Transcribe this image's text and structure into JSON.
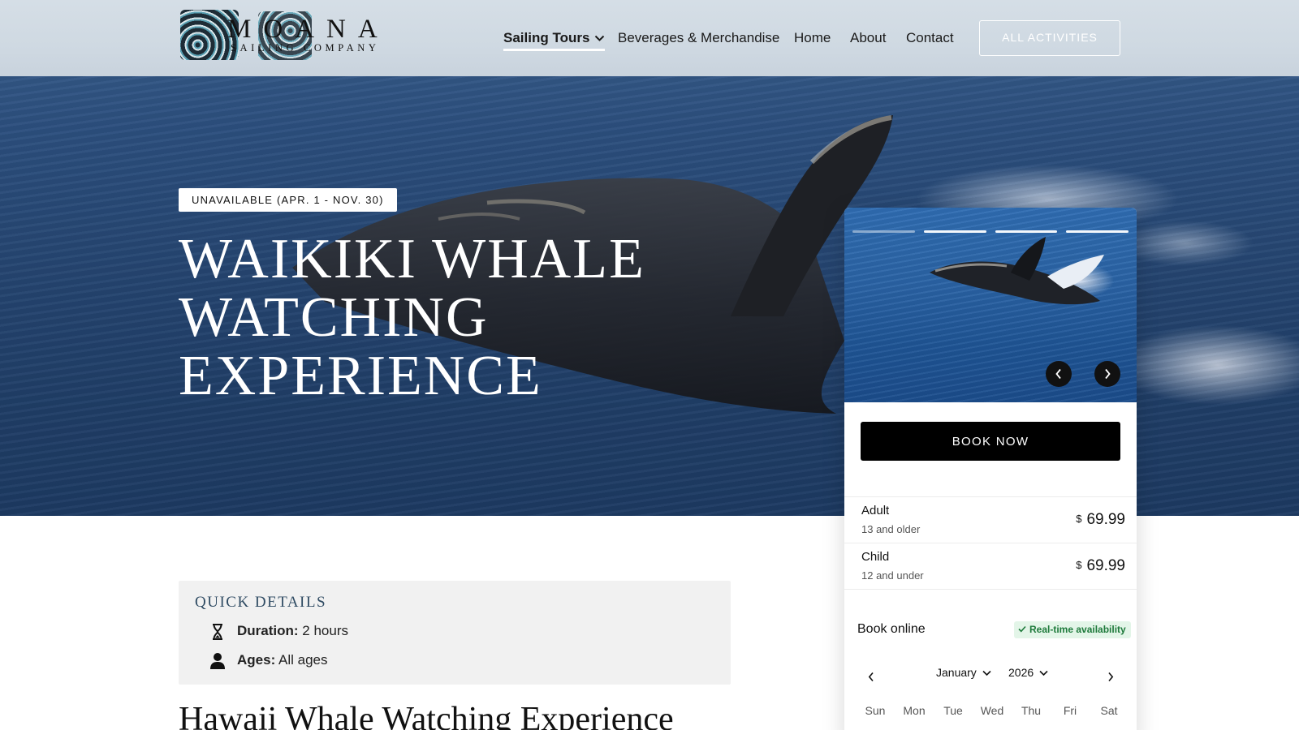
{
  "header": {
    "logo": {
      "wordmark": "MOANA",
      "tagline": "SAILING COMPANY"
    },
    "nav": [
      {
        "label": "Sailing Tours",
        "active": true,
        "has_dropdown": true
      },
      {
        "label": "Beverages & Merchandise"
      },
      {
        "label": "Home"
      },
      {
        "label": "About"
      },
      {
        "label": "Contact"
      }
    ],
    "cta_label": "ALL ACTIVITIES"
  },
  "hero": {
    "badge": "UNAVAILABLE (APR. 1 - NOV. 30)",
    "title_lines": [
      "WAIKIKI WHALE",
      "WATCHING",
      "EXPERIENCE"
    ]
  },
  "booking": {
    "carousel": {
      "slide_count": 4,
      "current_slide": 1,
      "prev_icon": "chevron-left-icon",
      "next_icon": "chevron-right-icon"
    },
    "book_now_label": "BOOK NOW",
    "prices": [
      {
        "name": "Adult",
        "sub": "13 and older",
        "currency": "$",
        "amount": "69.99"
      },
      {
        "name": "Child",
        "sub": "12 and under",
        "currency": "$",
        "amount": "69.99"
      }
    ],
    "book_online_label": "Book online",
    "availability_badge": "Real-time availability",
    "calendar": {
      "month": "January",
      "year": "2026",
      "weekdays": [
        "Sun",
        "Mon",
        "Tue",
        "Wed",
        "Thu",
        "Fri",
        "Sat"
      ]
    }
  },
  "quick_details": {
    "title": "Quick Details",
    "items": [
      {
        "icon": "hourglass-icon",
        "label": "Duration:",
        "value": "2 hours"
      },
      {
        "icon": "person-icon",
        "label": "Ages:",
        "value": "All ages"
      }
    ]
  },
  "content": {
    "heading": "Hawaii Whale Watching Experience"
  },
  "colors": {
    "header_bg": "#cfd9e2",
    "ocean": "#24446f",
    "availability_green": "#1e7a3b",
    "availability_bg": "#e3f5e8",
    "quick_details_title": "#2f4b63"
  }
}
